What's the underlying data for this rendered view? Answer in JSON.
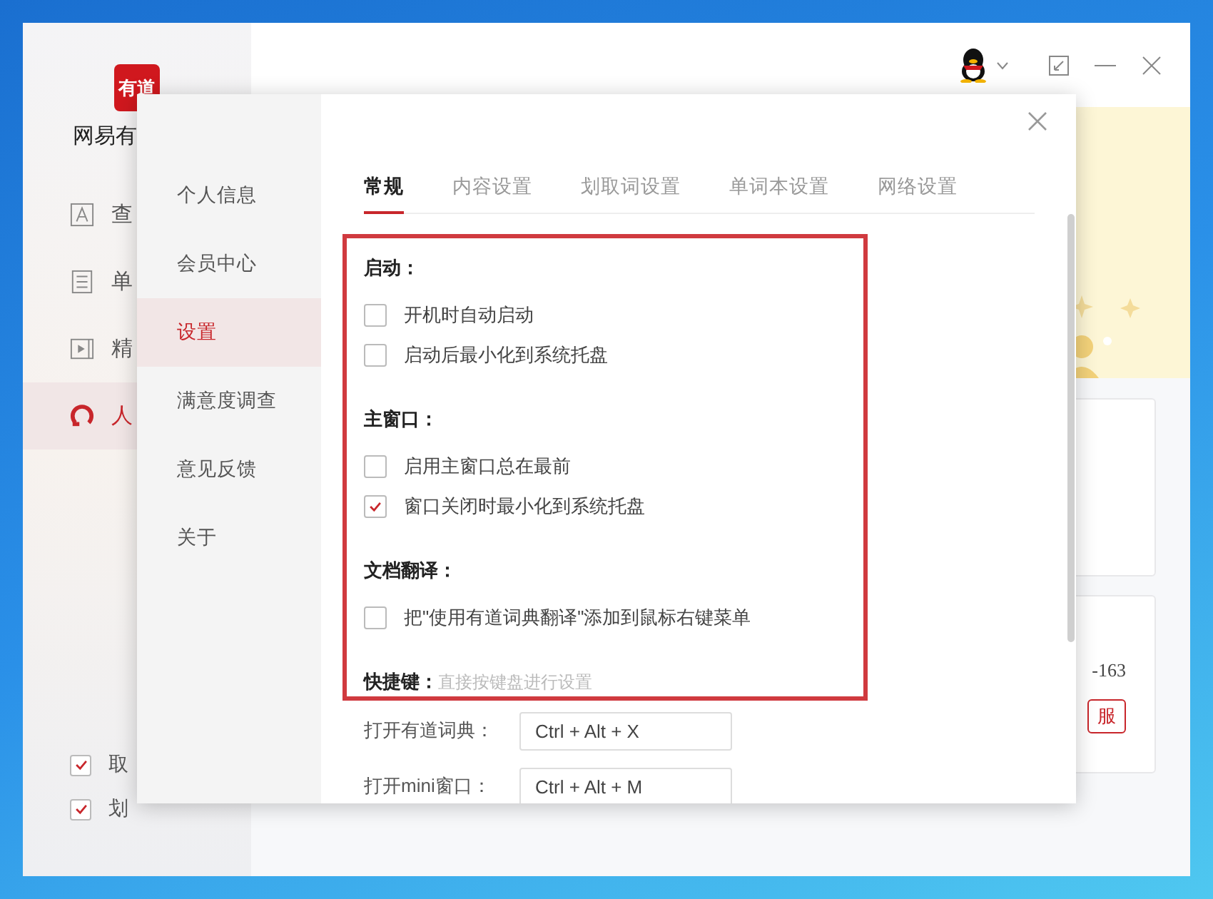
{
  "app": {
    "logo_text": "有道",
    "name": "网易有",
    "nav": [
      {
        "label": "查",
        "kind": "dictionary",
        "selected": false
      },
      {
        "label": "单",
        "kind": "wordbook",
        "selected": false
      },
      {
        "label": "精",
        "kind": "video",
        "selected": false
      },
      {
        "label": "人",
        "kind": "human",
        "selected": true
      }
    ],
    "bottom_options": [
      {
        "label": "取",
        "checked": true
      },
      {
        "label": "划",
        "checked": true
      }
    ],
    "card_text": "-163",
    "card_button": "服"
  },
  "dialog": {
    "menu": [
      {
        "label": "个人信息",
        "selected": false
      },
      {
        "label": "会员中心",
        "selected": false
      },
      {
        "label": "设置",
        "selected": true
      },
      {
        "label": "满意度调查",
        "selected": false
      },
      {
        "label": "意见反馈",
        "selected": false
      },
      {
        "label": "关于",
        "selected": false
      }
    ],
    "tabs": [
      {
        "label": "常规",
        "selected": true
      },
      {
        "label": "内容设置",
        "selected": false
      },
      {
        "label": "划取词设置",
        "selected": false
      },
      {
        "label": "单词本设置",
        "selected": false
      },
      {
        "label": "网络设置",
        "selected": false
      }
    ],
    "sections": [
      {
        "title": "启动：",
        "items": [
          {
            "label": "开机时自动启动",
            "checked": false
          },
          {
            "label": "启动后最小化到系统托盘",
            "checked": false
          }
        ]
      },
      {
        "title": "主窗口：",
        "items": [
          {
            "label": "启用主窗口总在最前",
            "checked": false
          },
          {
            "label": "窗口关闭时最小化到系统托盘",
            "checked": true
          }
        ]
      },
      {
        "title": "文档翻译：",
        "items": [
          {
            "label": "把\"使用有道词典翻译\"添加到鼠标右键菜单",
            "checked": false
          }
        ]
      },
      {
        "title": "快捷键：",
        "hint": "直接按键盘进行设置"
      }
    ],
    "hotkeys": [
      {
        "label": "打开有道词典：",
        "value": "Ctrl + Alt + X"
      },
      {
        "label": "打开mini窗口：",
        "value": "Ctrl + Alt + M"
      }
    ]
  }
}
